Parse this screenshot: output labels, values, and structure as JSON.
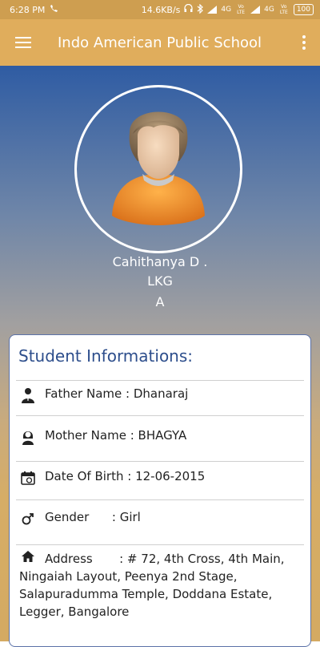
{
  "status_bar": {
    "time": "6:28 PM",
    "network_speed": "14.6KB/s",
    "network_1": "4G",
    "network_2": "4G",
    "volte_1": "Vo LTE",
    "volte_2": "Vo LTE",
    "battery": "100"
  },
  "app_bar": {
    "title": "Indo American Public School",
    "menu_icon": "hamburger-menu-icon",
    "more_icon": "more-vert-icon"
  },
  "profile": {
    "name": "Cahithanya D .",
    "class": "LKG",
    "section": "A"
  },
  "info": {
    "heading": "Student Informations:",
    "father_label": "Father Name",
    "father_value": " : Dhanaraj",
    "mother_label": "Mother Name",
    "mother_value": " : BHAGYA",
    "dob_label": "Date Of Birth",
    "dob_value": " : 12-06-2015",
    "gender_label": "Gender",
    "gender_value": "      : Girl",
    "address_line1": "Address       : # 72, 4th Cross, 4th Main,",
    "address_line2": "Ningaiah Layout, Peenya 2nd Stage,",
    "address_line3": "Salapuradumma Temple, Doddana Estate,",
    "address_line4": "Legger, Bangalore"
  },
  "colors": {
    "app_bar": "#e0ad5c",
    "status_bar": "#ce9e50",
    "heading": "#2d4e8c"
  }
}
